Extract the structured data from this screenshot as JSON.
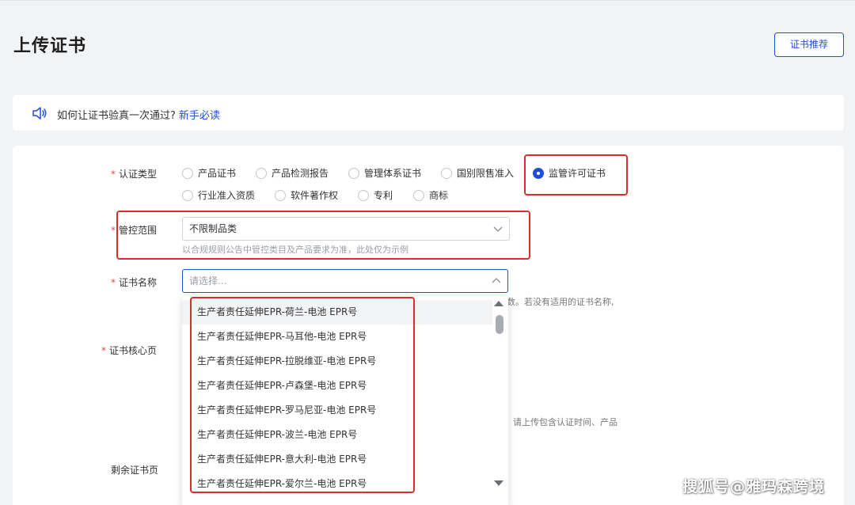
{
  "page": {
    "title": "上传证书"
  },
  "header": {
    "recommend_button": "证书推荐"
  },
  "notice": {
    "text": "如何让证书验真一次通过?",
    "link": "新手必读"
  },
  "form": {
    "cert_type": {
      "label": "认证类型",
      "options": [
        "产品证书",
        "产品检测报告",
        "管理体系证书",
        "国别限售准入",
        "监管许可证书",
        "行业准入资质",
        "软件著作权",
        "专利",
        "商标"
      ],
      "selected": "监管许可证书"
    },
    "control_scope": {
      "label": "管控范围",
      "value": "不限制品类",
      "hint": "以合规规则公告中管控类目及产品要求为准，此处仅为示例"
    },
    "cert_name": {
      "label": "证书名称",
      "placeholder": "请选择...",
      "hint_partial": "数。若没有适用的证书名称,"
    },
    "core_page": {
      "label": "证书核心页",
      "hint_partial": "请上传包含认证时间、产品"
    },
    "remaining_pages": {
      "label": "剩余证书页"
    }
  },
  "dropdown": {
    "items": [
      "生产者责任延伸EPR-荷兰-电池 EPR号",
      "生产者责任延伸EPR-马耳他-电池 EPR号",
      "生产者责任延伸EPR-拉脱维亚-电池 EPR号",
      "生产者责任延伸EPR-卢森堡-电池 EPR号",
      "生产者责任延伸EPR-罗马尼亚-电池 EPR号",
      "生产者责任延伸EPR-波兰-电池 EPR号",
      "生产者责任延伸EPR-意大利-电池 EPR号",
      "生产者责任延伸EPR-爱尔兰-电池 EPR号"
    ]
  },
  "watermark": "搜狐号@雅玛森跨境",
  "colors": {
    "accent": "#1f4fd6",
    "required": "#e5484d",
    "highlight_box": "#d6302b"
  },
  "icons": {
    "notice": "speaker-icon",
    "select": "chevron-down-icon",
    "select_open": "chevron-up-icon"
  }
}
